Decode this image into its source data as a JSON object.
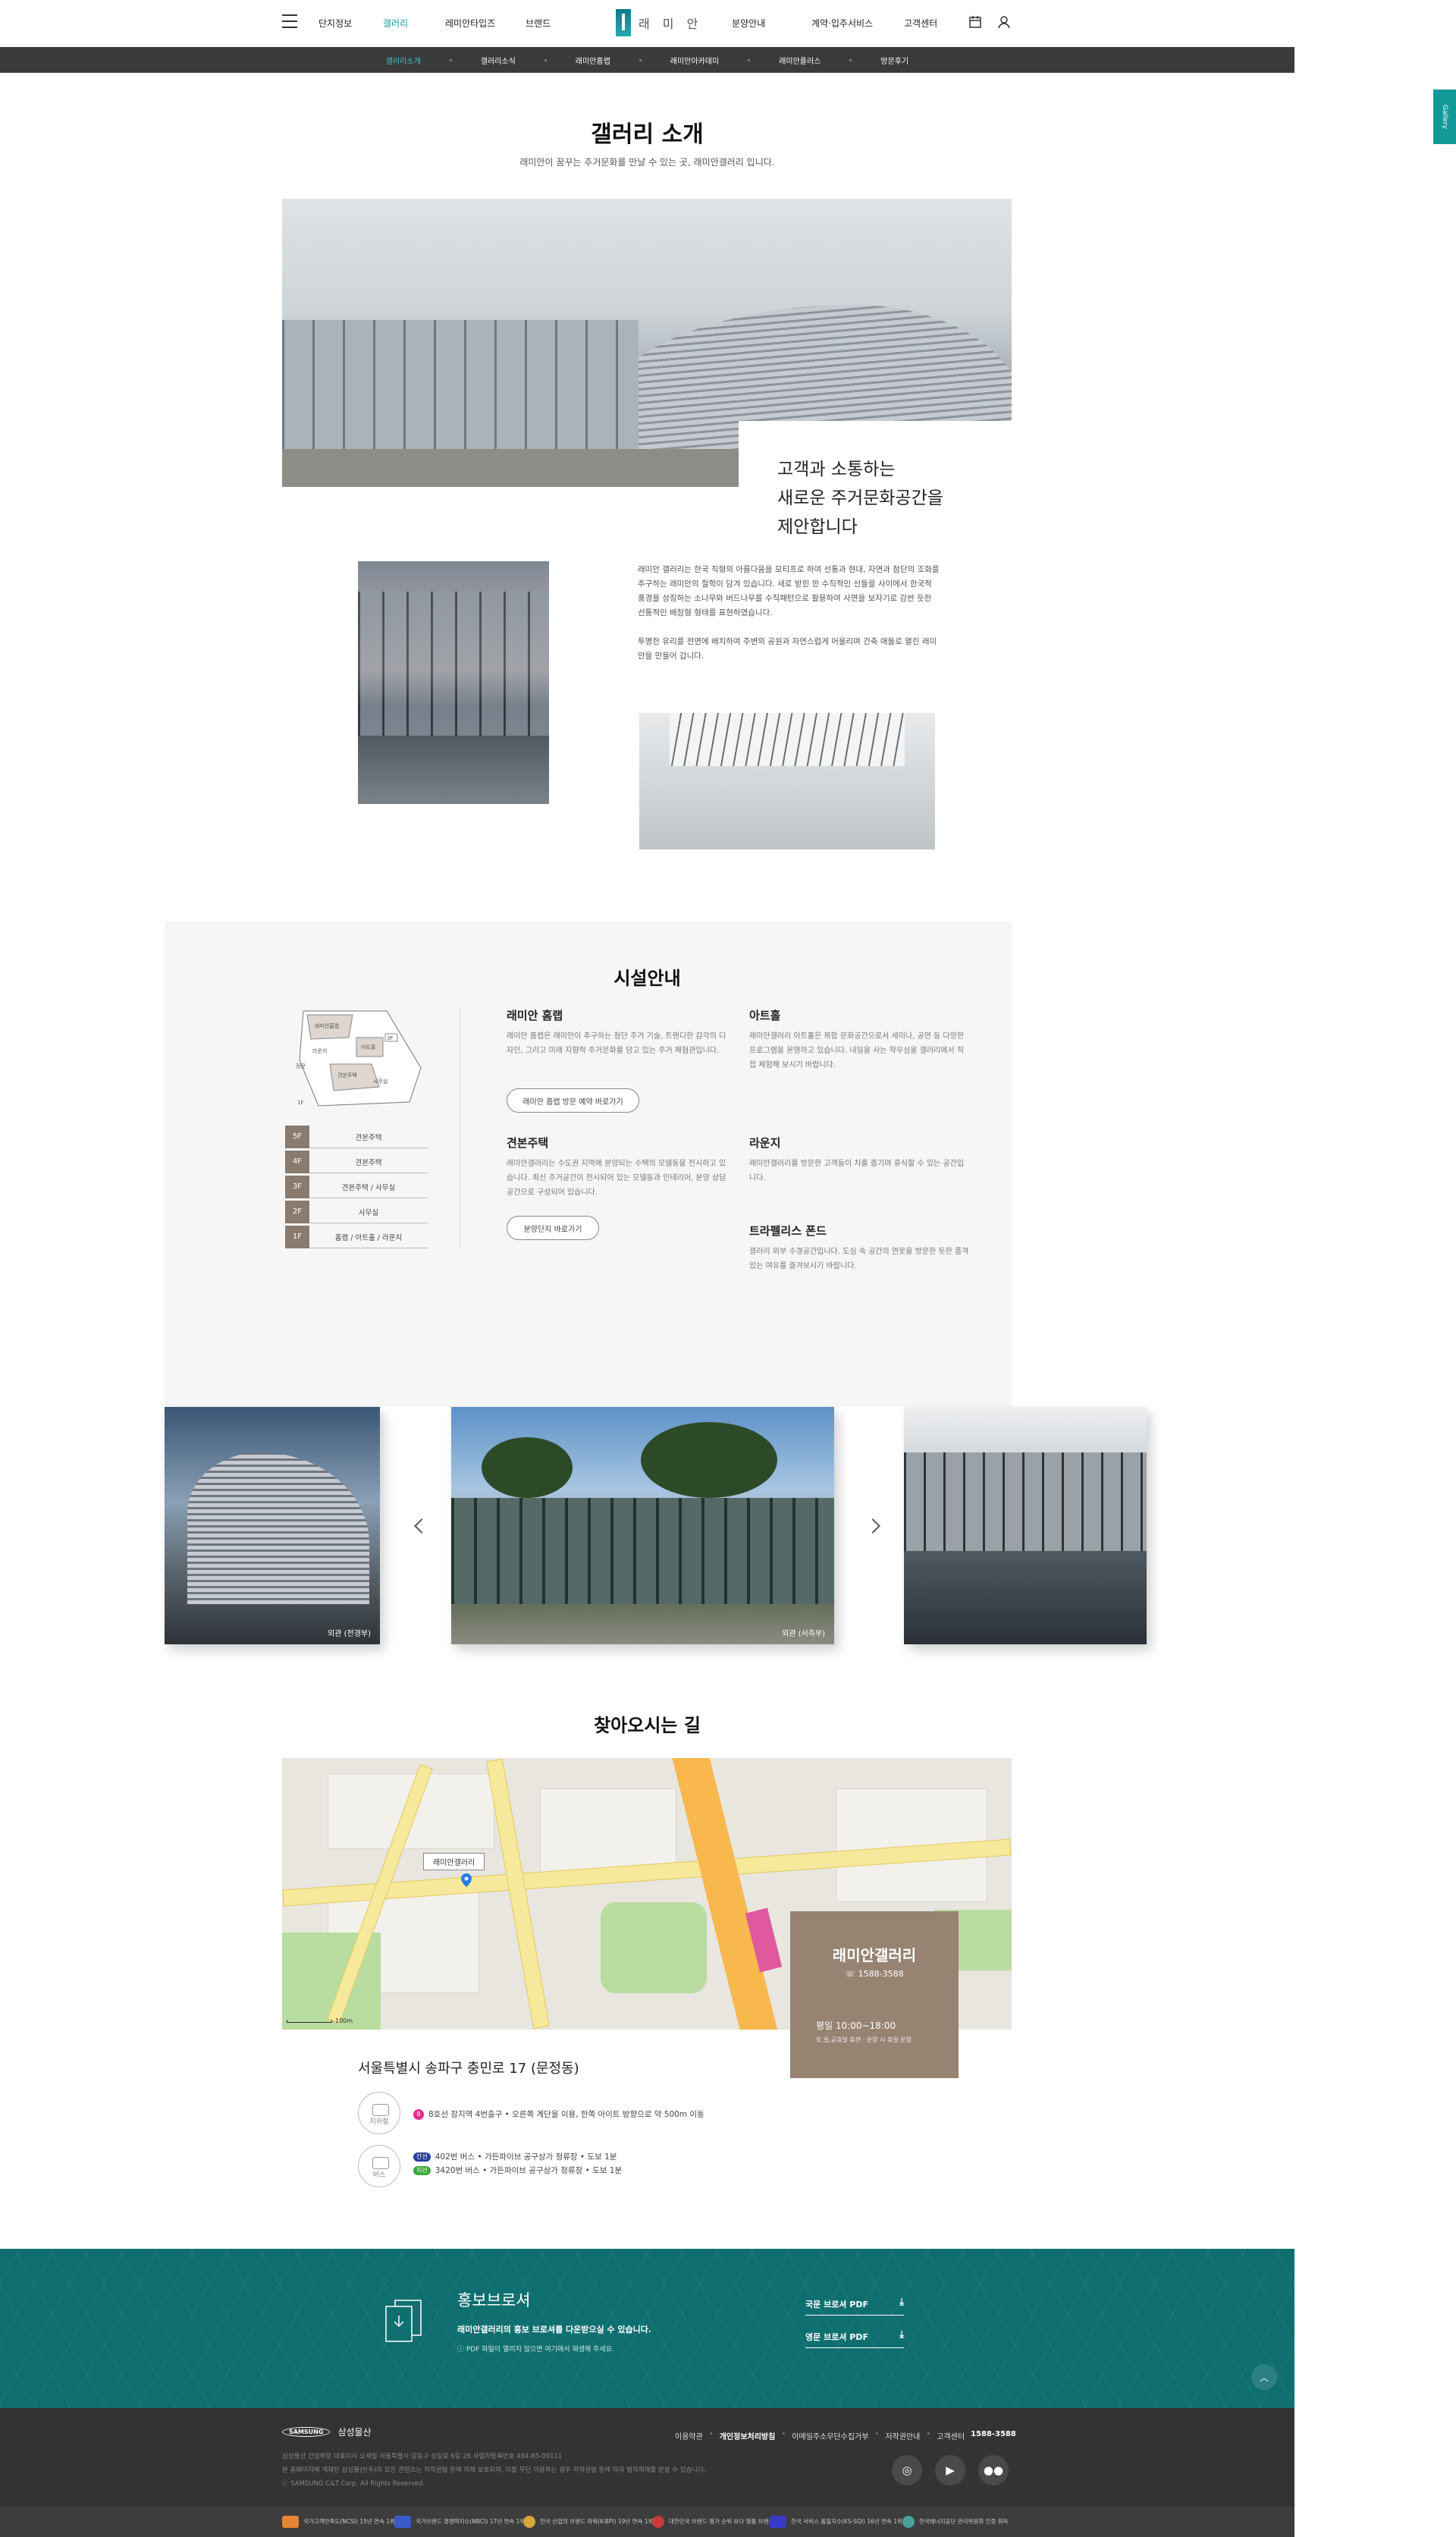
{
  "header": {
    "nav_left": [
      "단지정보",
      "갤러리",
      "레미안타입즈",
      "브랜드"
    ],
    "logo": "래 미 안",
    "nav_right": [
      "분양안내",
      "계약·입주서비스",
      "고객센터"
    ]
  },
  "subnav": [
    "갤러리소개",
    "갤러리소식",
    "래미안홈랩",
    "래미안아카데미",
    "래미안플러스",
    "방문후기"
  ],
  "side_tab": "Gallery",
  "intro": {
    "title": "갤러리 소개",
    "subtitle": "래미안이 꿈꾸는 주거문화를 만날 수 있는 곳,  래미안갤러리 입니다.",
    "quote_lines": [
      "고객과 소통하는",
      "새로운 주거문화공간을",
      "제안합니다"
    ],
    "para1": "래미안 갤러리는 한국 직형의 아름다움을 모티프로 하여 선통과 현대, 자연과 첨단의 조화를 추구하는 래미안의 철학이 담겨 있습니다. 새로 받힌 한 수직적인 선들을 사이에서 한국적 풍경을 상징하는 소나무와 버드나무를 수직패턴으로 활용하여 사면을 보자기로 감싼 듯한 선통적인 배참형 형태를 표현하였습니다.",
    "para2": "투명한 유리를 전면에 배치하여 주변의 공원과 자연스럽게 어울리며 건축 애들로 열린 래미안을 만들어 갑니다."
  },
  "facilities": {
    "title": "시설안내",
    "map_labels": [
      "래미안홈랩",
      "3F",
      "라운지",
      "아트홀",
      "견본주택",
      "사무실",
      "정문",
      "1F"
    ],
    "floors": [
      {
        "floor": "5F",
        "name": "견본주택"
      },
      {
        "floor": "4F",
        "name": "견본주택"
      },
      {
        "floor": "3F",
        "name": "견본주택 / 사무실"
      },
      {
        "floor": "2F",
        "name": "사무실"
      },
      {
        "floor": "1F",
        "name": "홈랩 / 아트홀 / 라운지"
      }
    ],
    "items": [
      {
        "title": "래미안 홈랩",
        "desc": "래미안 홈랩은 래미안이 추구하는 첨단 주거 기술, 트렌디한 감각의 디자인, 그리고 미래 지향적 주거문화를 담고 있는 주거 체험관입니다.",
        "button": "래미안 홈랩 방문 예약 바로가기"
      },
      {
        "title": "아트홀",
        "desc": "래미안갤러리 아트홀은 복합 문화공간으로서 세미나, 공연 등 다양한 프로그램을 운영하고 있습니다. 내일을 사는 착우심을 갤러리에서 직접 체험해 보시기 바랍니다."
      },
      {
        "title": "견본주택",
        "desc": "래미안갤러리는 수도권 지역에 분양되는 수택의 모델동을 전시하고 있습니다. 최신 주거공간이 전시되어 있는 모델동과 인테리어, 분양 상담 공간으로 구성되어 있습니다.",
        "button": "분양단지 바로가기"
      },
      {
        "title": "라운지",
        "desc": "래미안갤러리를 방문한 고객들이 차를 즐기며 휴식할 수 있는 공간입니다."
      },
      {
        "title": "트라펠리스 폰드",
        "desc": "갤러리 외부 수경공간입니다. 도심 속 공간의 연못을 방문한 듯한 품격있는 여유를 즐겨보시기 바랍니다."
      }
    ]
  },
  "carousel": {
    "captions": [
      "외관 (전경부)",
      "외관 (서측부)"
    ]
  },
  "directions": {
    "title": "찾아오시는 길",
    "map_marker": "래미안갤러리",
    "box_title": "래미안갤러리",
    "phone": "1588-3588",
    "hours": "평일 10:00~18:00",
    "hours_note": "토,일,공휴일 휴관 · 분양 시 휴일 운영",
    "address": "서울특별시 송파구 충민로 17 (문정동)",
    "subway_label": "지하철",
    "subway_badge": "8",
    "subway_text": "8호선 장지역 4번출구  •  오른쪽 계단을 이용, 한쪽 아이트 방향으로 약 500m 이동",
    "bus_label": "버스",
    "bus_rows": [
      {
        "badge": "간선",
        "text": "402번 버스  •  가든파이브 공구상가 정류장  •  도보 1분"
      },
      {
        "badge": "지선",
        "text": "3420번 버스  •  가든파이브 공구상가 정류장  •  도보 1분"
      }
    ],
    "scale": "100m"
  },
  "brochure": {
    "title": "홍보브로셔",
    "desc": "래미안갤러리의 홍보 브로셔를 다운받으실 수 있습니다.",
    "note": "PDF 파일이 열리지 않으면 여기에서 재생해 주세요.",
    "pdf_kr": "국문 브로셔 PDF",
    "pdf_en": "영문 브로셔 PDF"
  },
  "footer": {
    "company_logo": "SAMSUNG",
    "company": "삼성물산",
    "links": [
      "이용약관",
      "개인정보처리방침",
      "이메일주소무단수집거부",
      "저작권안내",
      "고객센터"
    ],
    "phone": "1588-3588",
    "info1": "삼성물산 건설부문 대표이사 오세철   서울특별시 강동구 상일로 6길 26   사업자등록번호 484-85-00111",
    "info2": "본 홈페이지에 게재된 삼성물산(주)의 모든 콘텐츠는 저작권법 등에 의해 보호되며, 이를 무단 이용하는 경우 저작권법 등에 따라 법적제재를 받을 수 있습니다.",
    "copyright": "ⓒ SAMSUNG C&T Corp. All Rights Reserved.",
    "certs": [
      "국가고객만족도(NCSI) 15년 연속 1위",
      "국가브랜드 경쟁력지수(NBCI) 17년 연속 1위",
      "한국 산업의 브랜드 파워(K-BPI) 19년 연속 1위",
      "대한민국 브랜드 평가 순위 보다 명품 브랜드 1위",
      "한국 서비스 품질지수(KS-SQI) 16년 연속 1위",
      "한국에너지공단 관리위원회 인증 취득"
    ]
  },
  "colors": {
    "accent": "#1a9a9a",
    "teal_band": "#0f6f70",
    "brown": "#978372",
    "dark": "#333333"
  }
}
